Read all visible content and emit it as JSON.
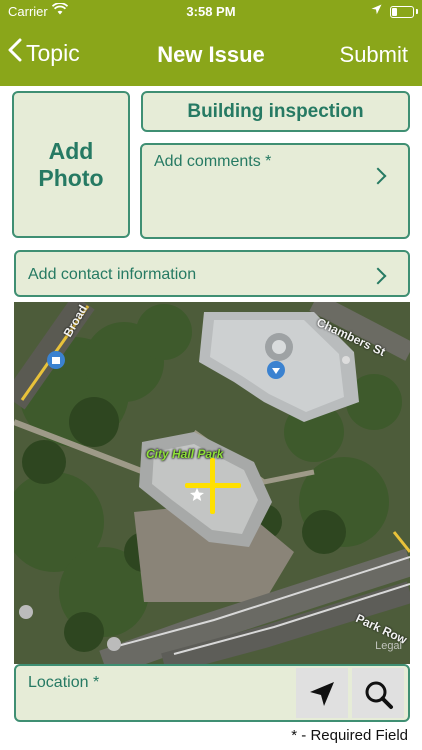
{
  "status_bar": {
    "carrier": "Carrier",
    "time": "3:58 PM"
  },
  "nav": {
    "back_label": "Topic",
    "title": "New Issue",
    "submit_label": "Submit"
  },
  "form": {
    "add_photo_line1": "Add",
    "add_photo_line2": "Photo",
    "topic": "Building inspection",
    "comments_label": "Add comments *",
    "contact_label": "Add contact information",
    "location_label": "Location *",
    "required_note": "* - Required Field"
  },
  "map": {
    "park_label": "City Hall Park",
    "street_chambers": "Chambers St",
    "street_park_row": "Park Row",
    "street_broadway": "Broad",
    "legal": "Legal"
  },
  "colors": {
    "nav_bar": "#8aa61a",
    "field_background": "#e6ecd7",
    "accent": "#267a63",
    "crosshair": "#ffe000"
  },
  "icons": {
    "back": "chevron-left-icon",
    "gps": "location-arrow-icon",
    "search": "magnifier-icon"
  }
}
